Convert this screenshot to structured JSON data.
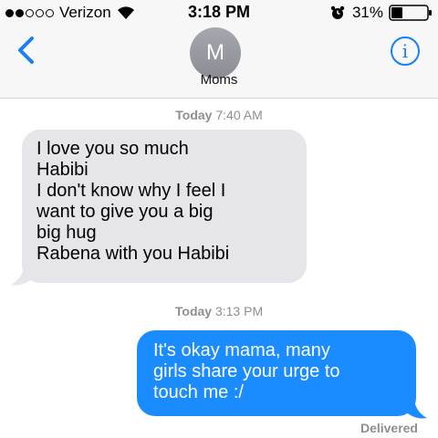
{
  "status_bar": {
    "carrier": "Verizon",
    "time": "3:18 PM",
    "battery_percent": "31%",
    "battery_level": 0.31,
    "signal_bars_filled": 2,
    "signal_bars_total": 5,
    "icons": [
      "signal-dots-icon",
      "wifi-icon",
      "alarm-icon",
      "battery-icon"
    ]
  },
  "nav": {
    "back_icon": "chevron-left-icon",
    "avatar_initial": "M",
    "contact_name": "Moms",
    "info_label": "i"
  },
  "thread": {
    "timestamp_1": {
      "day": "Today",
      "time": "7:40 AM"
    },
    "incoming_message": {
      "lines": [
        "I love you so much",
        "Habibi",
        "I don't know why I feel I",
        "want to give you a big",
        "big hug",
        "Rabena with you Habibi"
      ]
    },
    "timestamp_2": {
      "day": "Today",
      "time": "3:13 PM"
    },
    "outgoing_message": {
      "lines": [
        "It's okay mama, many",
        "girls share your urge to",
        "touch me :/"
      ]
    },
    "delivery_status": "Delivered"
  },
  "colors": {
    "accent": "#1a7ef7",
    "incoming_bubble": "#e5e5ea",
    "outgoing_bubble": "#1a8cff",
    "meta_text": "#8e8e93"
  }
}
